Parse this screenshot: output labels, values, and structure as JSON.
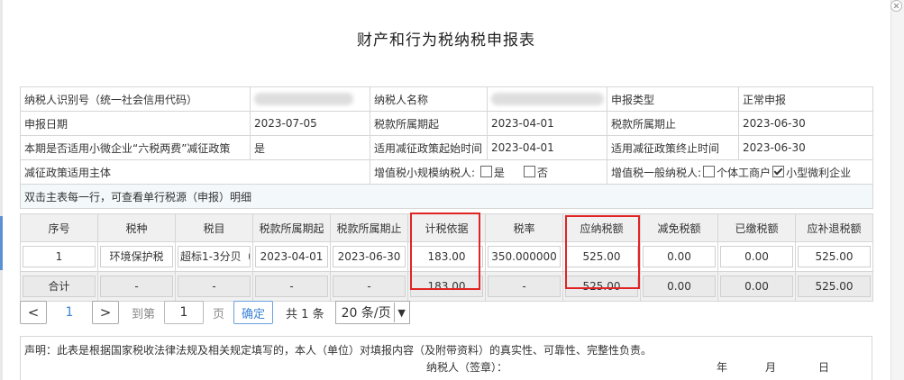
{
  "title": "财产和行为税纳税申报表",
  "info": {
    "taxpayer_id_label": "纳税人识别号（统一社会信用代码）",
    "taxpayer_name_label": "纳税人名称",
    "declare_type_label": "申报类型",
    "declare_type_value": "正常申报",
    "declare_date_label": "申报日期",
    "declare_date_value": "2023-07-05",
    "period_start_label": "税款所属期起",
    "period_start_value": "2023-04-01",
    "period_end_label": "税款所属期止",
    "period_end_value": "2023-06-30",
    "small_micro_label": "本期是否适用小微企业“六税两费”减征政策",
    "small_micro_value": "是",
    "reduce_start_label": "适用减征政策起始时间",
    "reduce_start_value": "2023-04-01",
    "reduce_end_label": "适用减征政策终止时间",
    "reduce_end_value": "2023-06-30",
    "reduce_subject_label": "减征政策适用主体",
    "vat_small_label": "增值税小规模纳税人:",
    "vat_small_yes": "是",
    "vat_small_no": "否",
    "vat_general_label": "增值税一般纳税人:",
    "individual_label": "个体工商户",
    "small_micro_ent_label": "小型微利企业",
    "hint": "双击主表每一行，可查看单行税源（申报）明细"
  },
  "grid": {
    "headers": [
      "序号",
      "税种",
      "税目",
      "税款所属期起",
      "税款所属期止",
      "计税依据",
      "税率",
      "应纳税额",
      "减免税额",
      "已缴税额",
      "应补退税额"
    ],
    "row": [
      "1",
      "环境保护税",
      "超标1-3分贝（昼）",
      "2023-04-01",
      "2023-06-30",
      "183.00",
      "350.000000",
      "525.00",
      "0.00",
      "0.00",
      "525.00"
    ],
    "total": [
      "合计",
      "-",
      "-",
      "-",
      "-",
      "183.00",
      "-",
      "525.00",
      "0.00",
      "0.00",
      "525.00"
    ]
  },
  "pager": {
    "prev": "<",
    "current": "1",
    "next": ">",
    "goto_label": "到第",
    "goto_value": "1",
    "page_unit": "页",
    "confirm": "确定",
    "total": "共 1 条",
    "page_size": "20 条/页"
  },
  "declaration": {
    "text": "声明：此表是根据国家税收法律法规及相关规定填写的，本人（单位）对填报内容（及附带资料）的真实性、可靠性、完整性负责。",
    "signature": "纳税人（签章）：",
    "year": "年",
    "month": "月",
    "day": "日"
  },
  "colors": {
    "highlight": "#e02424",
    "link": "#3b82d6"
  }
}
